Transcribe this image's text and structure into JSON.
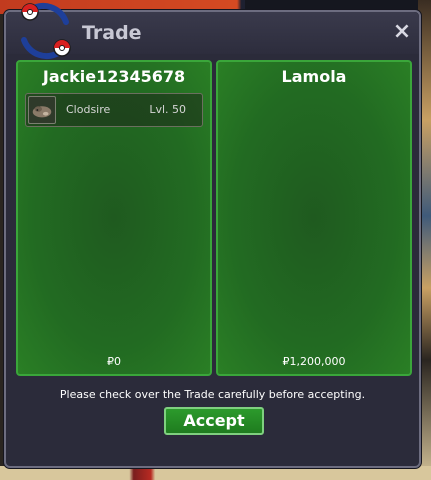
{
  "window": {
    "title": "Trade",
    "close_label": "×",
    "icon": "trade-arrows-icon"
  },
  "left_panel": {
    "player": "Jackie12345678",
    "items": [
      {
        "icon": "clodsire-icon",
        "name": "Clodsire",
        "level": "Lvl. 50"
      }
    ],
    "money": "₽0"
  },
  "right_panel": {
    "player": "Lamola",
    "items": [],
    "money": "₽1,200,000"
  },
  "footer": {
    "notice": "Please check over the Trade carefully before accepting.",
    "accept_label": "Accept"
  },
  "colors": {
    "panel_green": "#226b22",
    "panel_border": "#3aa63a",
    "accept_green": "#2c9a2c",
    "window_bg": "#2b2b3a"
  }
}
